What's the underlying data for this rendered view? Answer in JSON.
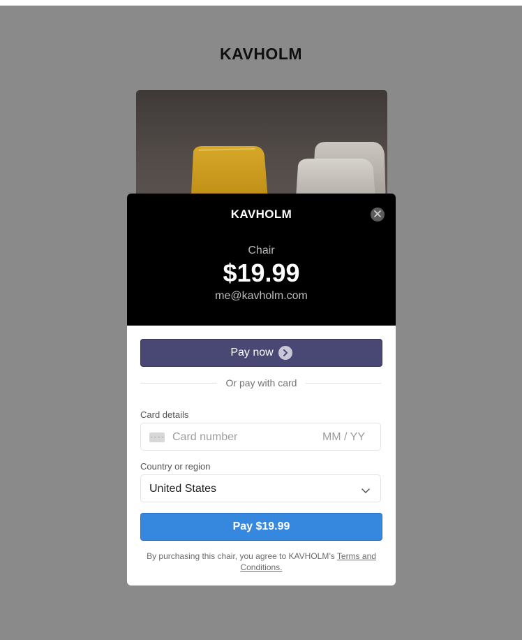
{
  "page": {
    "brand": "KAVHOLM"
  },
  "modal": {
    "brand": "KAVHOLM",
    "product_name": "Chair",
    "price": "$19.99",
    "email": "me@kavholm.com",
    "pay_now_label": "Pay now",
    "divider_text": "Or pay with card",
    "card_details_label": "Card details",
    "card_number_placeholder": "Card number",
    "card_expiry_placeholder": "MM / YY",
    "card_icon_glyph": "----",
    "country_label": "Country or region",
    "country_value": "United States",
    "pay_button_label": "Pay $19.99",
    "legal_text": "By purchasing this chair, you agree to KAVHOLM’s ",
    "legal_link": "Terms and Conditions."
  },
  "icons": {
    "close": "close-icon",
    "pay_now": "chevron-right-icon",
    "card": "credit-card-icon",
    "select": "chevron-down-icon"
  },
  "colors": {
    "overlay": "#8a8a8a",
    "header_bg": "#000000",
    "pay_now_button": "#494774",
    "pay_button": "#3688df"
  }
}
